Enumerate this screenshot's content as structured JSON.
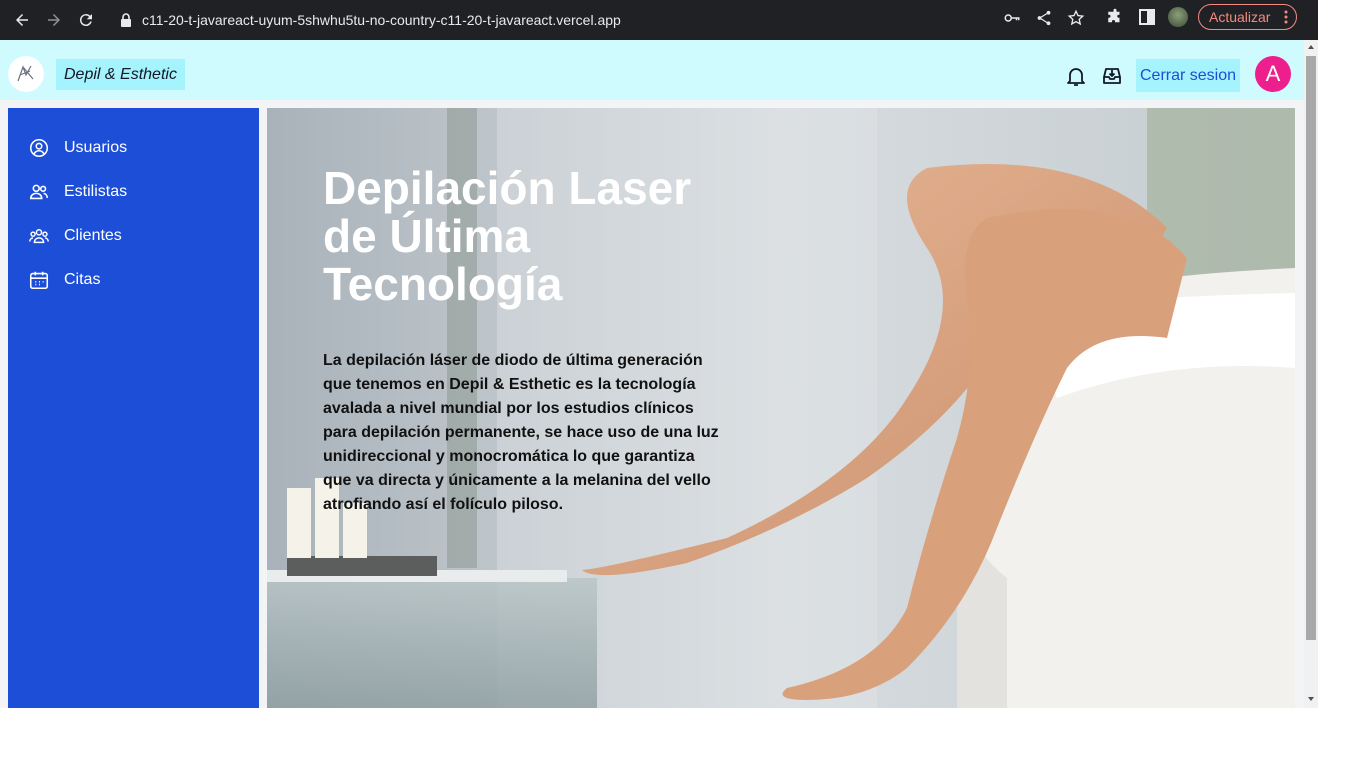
{
  "browser": {
    "url": "c11-20-t-javareact-uyum-5shwhu5tu-no-country-c11-20-t-javareact.vercel.app",
    "update_label": "Actualizar"
  },
  "header": {
    "brand": "Depil & Esthetic",
    "logout_label": "Cerrar sesion",
    "avatar_letter": "A"
  },
  "sidebar": {
    "items": [
      {
        "label": "Usuarios",
        "icon": "user-circle-icon"
      },
      {
        "label": "Estilistas",
        "icon": "users-icon"
      },
      {
        "label": "Clientes",
        "icon": "user-group-icon"
      },
      {
        "label": "Citas",
        "icon": "calendar-icon"
      }
    ]
  },
  "hero": {
    "title": "Depilación Laser de Última Tecnología",
    "text": "La depilación láser de diodo de última generación que tenemos en Depil & Esthetic es la tecnología avalada a nivel mundial por los estudios clínicos para depilación permanente, se hace uso de una luz unidireccional y monocromática lo que garantiza que va directa y únicamente a la melanina del vello atrofiando así el folículo piloso."
  },
  "colors": {
    "header_bg": "#cffafe",
    "sidebar_bg": "#1d4ed8",
    "avatar_bg": "#ec1f8c",
    "accent_chip": "#a5f3fc"
  }
}
